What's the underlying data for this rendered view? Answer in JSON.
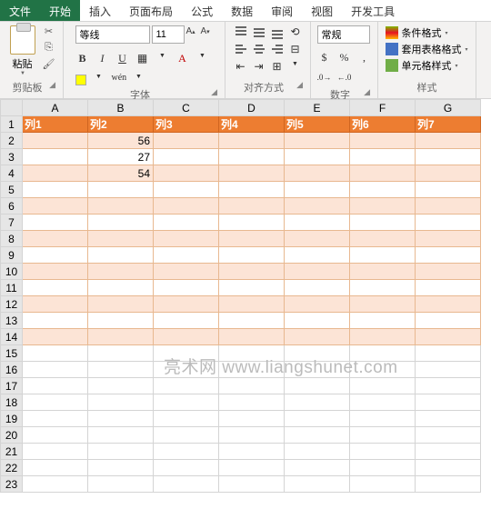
{
  "tabs": {
    "file": "文件",
    "home": "开始",
    "insert": "插入",
    "layout": "页面布局",
    "formula": "公式",
    "data": "数据",
    "review": "审阅",
    "view": "视图",
    "dev": "开发工具"
  },
  "ribbon": {
    "clipboard": {
      "label": "剪贴板",
      "paste": "粘贴"
    },
    "font": {
      "label": "字体",
      "name": "等线",
      "size": "11",
      "wen": "wén"
    },
    "align": {
      "label": "对齐方式"
    },
    "number": {
      "label": "数字",
      "format": "常规"
    },
    "styles": {
      "label": "样式",
      "cond": "条件格式",
      "table": "套用表格格式",
      "cell": "单元格样式"
    }
  },
  "grid": {
    "cols": [
      "A",
      "B",
      "C",
      "D",
      "E",
      "F",
      "G"
    ],
    "headers": [
      "列1",
      "列2",
      "列3",
      "列4",
      "列5",
      "列6",
      "列7"
    ],
    "rows": [
      {
        "n": 1,
        "head": true
      },
      {
        "n": 2,
        "b": "56"
      },
      {
        "n": 3,
        "b": "27"
      },
      {
        "n": 4,
        "b": "54"
      },
      {
        "n": 5
      },
      {
        "n": 6
      },
      {
        "n": 7
      },
      {
        "n": 8
      },
      {
        "n": 9
      },
      {
        "n": 10
      },
      {
        "n": 11
      },
      {
        "n": 12
      },
      {
        "n": 13
      },
      {
        "n": 14
      },
      {
        "n": 15,
        "plain": true
      },
      {
        "n": 16,
        "plain": true
      },
      {
        "n": 17,
        "plain": true
      },
      {
        "n": 18,
        "plain": true
      },
      {
        "n": 19,
        "plain": true
      },
      {
        "n": 20,
        "plain": true
      },
      {
        "n": 21,
        "plain": true
      },
      {
        "n": 22,
        "plain": true
      },
      {
        "n": 23,
        "plain": true
      }
    ]
  },
  "watermark": "亮术网  www.liangshunet.com"
}
